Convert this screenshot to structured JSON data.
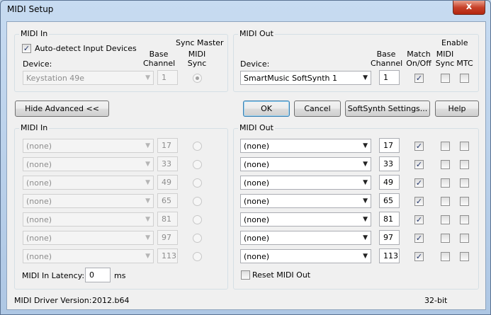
{
  "window": {
    "title": "MIDI Setup",
    "close_glyph": "x"
  },
  "midi_in_top": {
    "group_label": "MIDI In",
    "auto_detect_label": "Auto-detect Input Devices",
    "auto_detect_checked": true,
    "sync_master_label": "Sync Master",
    "device_label": "Device:",
    "base_channel_header_1": "Base",
    "base_channel_header_2": "Channel",
    "midi_sync_header_1": "MIDI",
    "midi_sync_header_2": "Sync",
    "device_value": "Keystation 49e",
    "base_channel_value": "1",
    "midi_sync_selected": true
  },
  "midi_out_top": {
    "group_label": "MIDI Out",
    "enable_label": "Enable",
    "device_label": "Device:",
    "base_channel_header_1": "Base",
    "base_channel_header_2": "Channel",
    "match_header_1": "Match",
    "match_header_2": "On/Off",
    "midi_sync_header_1": "MIDI",
    "midi_sync_header_2": "Sync",
    "mtc_header": "MTC",
    "device_value": "SmartMusic SoftSynth 1",
    "base_channel_value": "1",
    "match_checked": true,
    "midi_sync_checked": false,
    "mtc_checked": false
  },
  "buttons": {
    "hide_advanced": "Hide Advanced <<",
    "ok": "OK",
    "cancel": "Cancel",
    "softsynth_settings": "SoftSynth Settings...",
    "help": "Help"
  },
  "midi_in_adv": {
    "group_label": "MIDI In",
    "rows": [
      {
        "device": "(none)",
        "channel": "17"
      },
      {
        "device": "(none)",
        "channel": "33"
      },
      {
        "device": "(none)",
        "channel": "49"
      },
      {
        "device": "(none)",
        "channel": "65"
      },
      {
        "device": "(none)",
        "channel": "81"
      },
      {
        "device": "(none)",
        "channel": "97"
      },
      {
        "device": "(none)",
        "channel": "113"
      }
    ],
    "latency_label": "MIDI In Latency:",
    "latency_value": "0",
    "latency_unit": "ms"
  },
  "midi_out_adv": {
    "group_label": "MIDI Out",
    "rows": [
      {
        "device": "(none)",
        "channel": "17",
        "match": true,
        "sync": false,
        "mtc": false
      },
      {
        "device": "(none)",
        "channel": "33",
        "match": true,
        "sync": false,
        "mtc": false
      },
      {
        "device": "(none)",
        "channel": "49",
        "match": true,
        "sync": false,
        "mtc": false
      },
      {
        "device": "(none)",
        "channel": "65",
        "match": true,
        "sync": false,
        "mtc": false
      },
      {
        "device": "(none)",
        "channel": "81",
        "match": true,
        "sync": false,
        "mtc": false
      },
      {
        "device": "(none)",
        "channel": "97",
        "match": true,
        "sync": false,
        "mtc": false
      },
      {
        "device": "(none)",
        "channel": "113",
        "match": true,
        "sync": false,
        "mtc": false
      }
    ],
    "reset_label": "Reset MIDI Out",
    "reset_checked": false
  },
  "footer": {
    "driver_label": "MIDI Driver Version:",
    "driver_version": "2012.b64",
    "bitness": "32-bit"
  },
  "icons": {
    "dropdown": "chevron-down-icon",
    "check": "check-icon"
  }
}
